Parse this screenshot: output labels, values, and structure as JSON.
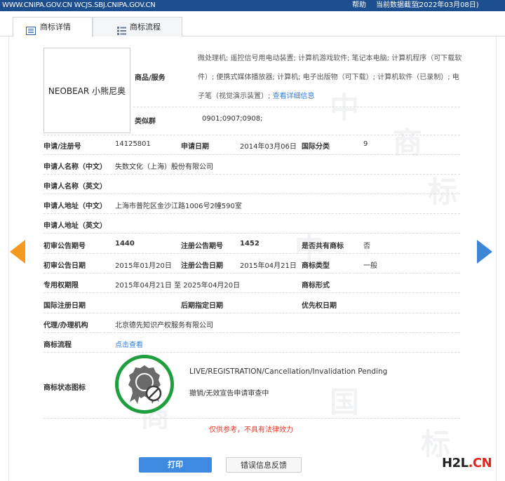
{
  "topbar": {
    "url": "WWW.CNIPA.GOV.CN WCJS.SBJ.CNIPA.GOV.CN",
    "help": "帮助",
    "deadline_label": "当前数据截至：",
    "deadline_date": "(2022年03月08日)"
  },
  "tabs": [
    {
      "label": "商标详情",
      "icon": "document-list-icon"
    },
    {
      "label": "商标流程",
      "icon": "grid-list-icon"
    }
  ],
  "trademark": {
    "logo_text": "NEOBEAR 小熊尼奥",
    "goods_label": "商品/服务",
    "goods_lines": [
      "微处理机; 遥控信号用电动装置; 计算机游戏软件; 笔记本电脑; 计算机程序（可下载软",
      "件）; 便携式媒体播放器; 计算机; 电子出版物（可下载）; 计算机软件（已录制）; 电",
      "子笔（视觉演示装置）; "
    ],
    "goods_more_link": "查看详细信息",
    "similar_group_label": "类似群",
    "similar_group_value": "0901;0907;0908;"
  },
  "fields": {
    "reg_no_label": "申请/注册号",
    "reg_no": "14125801",
    "app_date_label": "申请日期",
    "app_date": "2014年03月06日",
    "intl_class_label": "国际分类",
    "intl_class": "9",
    "applicant_cn_label": "申请人名称（中文）",
    "applicant_cn": "失数文化（上海）股份有限公司",
    "applicant_en_label": "申请人名称（英文）",
    "address_cn_label": "申请人地址（中文）",
    "address_cn": "上海市普陀区金沙江路1006号2幢590室",
    "address_en_label": "申请人地址（英文）",
    "prelim_no_label": "初审公告期号",
    "prelim_no": "1440",
    "reg_pub_no_label": "注册公告期号",
    "reg_pub_no": "1452",
    "shared_label": "是否共有商标",
    "shared": "否",
    "prelim_date_label": "初审公告日期",
    "prelim_date": "2015年01月20日",
    "reg_pub_date_label": "注册公告日期",
    "reg_pub_date": "2015年04月21日",
    "tm_type_label": "商标类型",
    "tm_type": "一般",
    "exclusive_label": "专用权期限",
    "exclusive": "2015年04月21日 至 2025年04月20日",
    "tm_form_label": "商标形式",
    "intl_reg_date_label": "国际注册日期",
    "later_date_label": "后期指定日期",
    "priority_date_label": "优先权日期",
    "agent_label": "代理/办理机构",
    "agent": "北京德先知识产权服务有限公司",
    "process_label": "商标流程",
    "process_link": "点击查看",
    "status_label": "商标状态图标",
    "status_en": "LIVE/REGISTRATION/Cancellation/Invalidation Pending",
    "status_cn": "撤销/无效宣告申请审查中"
  },
  "disclaimer": "仅供参考，不具有法律效力",
  "buttons": {
    "print": "打印",
    "feedback": "错误信息反馈"
  },
  "brand": {
    "h2l": "H2L",
    "cn": ".CN"
  },
  "watermark": {
    "chars": [
      "中",
      "国",
      "商",
      "标"
    ]
  },
  "colors": {
    "topbar": "#1d4f8f",
    "link": "#2f7ed8",
    "status_green": "#1e9e3e",
    "disclaimer": "#e03b2c",
    "print_button": "#3d8ae0",
    "arrow_left": "#f39a1e",
    "arrow_right": "#3d86d6",
    "brand_red": "#e1251b"
  }
}
